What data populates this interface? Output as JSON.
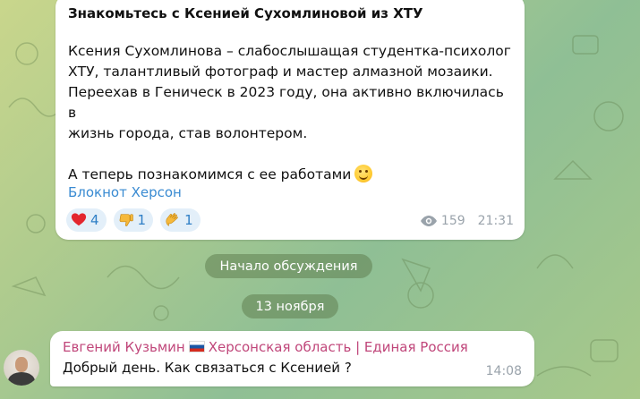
{
  "post": {
    "title": "Знакомьтесь с Ксенией Сухомлиновой из ХТУ",
    "paragraph1_lines": [
      "Ксения Сухомлинова – слабослышащая студентка-психолог",
      "ХТУ, талантливый фотограф и мастер алмазной мозаики.",
      "Переехав в Геническ в 2023 году, она активно включилась в",
      "жизнь города, став волонтером."
    ],
    "paragraph2": "А теперь познакомимся с ее работами",
    "paragraph2_emoji": "smiling-face-emoji",
    "author_link": "Блокнот Херсон",
    "reactions": [
      {
        "emoji": "red-heart",
        "count": "4"
      },
      {
        "emoji": "thumbs-down",
        "count": "1"
      },
      {
        "emoji": "clapping-hands",
        "count": "1"
      }
    ],
    "views": "159",
    "time": "21:31"
  },
  "discussion_pill": "Начало обсуждения",
  "date_pill": "13 ноября",
  "comment": {
    "author_name": "Евгений Кузьмин",
    "author_flag": "russia-flag",
    "author_suffix": "Херсонская область | Единая Россия",
    "text": "Добрый день. Как связаться с Ксенией ?",
    "time": "14:08"
  },
  "colors": {
    "link_blue": "#3a8bd2",
    "reaction_bg": "#e3eff9",
    "author_pink": "#c0467a",
    "meta_gray": "#9aa3ab"
  }
}
